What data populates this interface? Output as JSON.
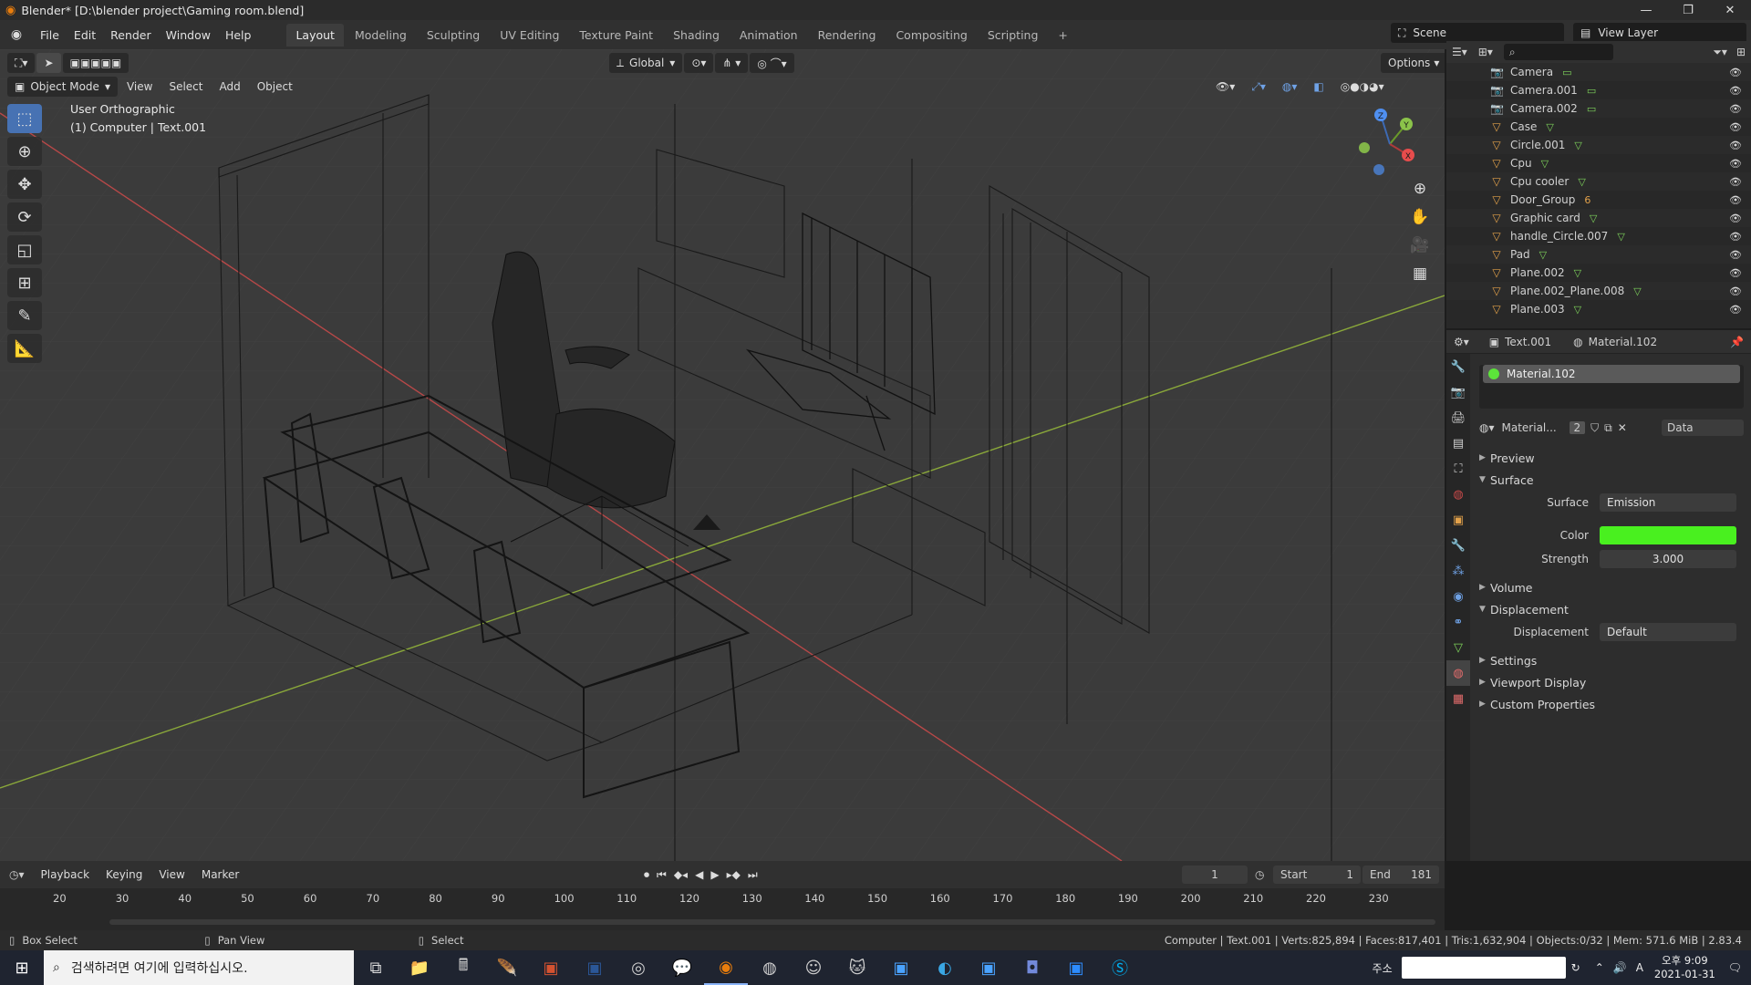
{
  "window": {
    "title": "Blender* [D:\\blender project\\Gaming room.blend]",
    "min": "—",
    "max": "❐",
    "close": "✕"
  },
  "menu": {
    "items": [
      "File",
      "Edit",
      "Render",
      "Window",
      "Help"
    ]
  },
  "workspaces": [
    "Layout",
    "Modeling",
    "Sculpting",
    "UV Editing",
    "Texture Paint",
    "Shading",
    "Animation",
    "Rendering",
    "Compositing",
    "Scripting",
    "+"
  ],
  "active_workspace": "Layout",
  "scene": {
    "label": "Scene",
    "view_layer": "View Layer"
  },
  "viewport": {
    "mode": "Object Mode",
    "menus": [
      "View",
      "Select",
      "Add",
      "Object"
    ],
    "transform": "Global",
    "options": "Options",
    "info_line1": "User Orthographic",
    "info_line2": "(1) Computer | Text.001",
    "gizmo": {
      "x": "X",
      "y": "Y",
      "z": "Z"
    }
  },
  "outliner": {
    "items": [
      {
        "name": "Camera",
        "type": "camera"
      },
      {
        "name": "Camera.001",
        "type": "camera"
      },
      {
        "name": "Camera.002",
        "type": "camera"
      },
      {
        "name": "Case",
        "type": "mesh"
      },
      {
        "name": "Circle.001",
        "type": "mesh"
      },
      {
        "name": "Cpu",
        "type": "mesh"
      },
      {
        "name": "Cpu cooler",
        "type": "mesh"
      },
      {
        "name": "Door_Group",
        "type": "mesh",
        "badge": "6"
      },
      {
        "name": "Graphic card",
        "type": "mesh"
      },
      {
        "name": "handle_Circle.007",
        "type": "mesh"
      },
      {
        "name": "Pad",
        "type": "mesh"
      },
      {
        "name": "Plane.002",
        "type": "mesh"
      },
      {
        "name": "Plane.002_Plane.008",
        "type": "mesh"
      },
      {
        "name": "Plane.003",
        "type": "mesh"
      }
    ]
  },
  "properties": {
    "object": "Text.001",
    "material": "Material.102",
    "slot": "Material.102",
    "mat_name": "Material...",
    "users": "2",
    "link": "Data",
    "panels": {
      "preview": "Preview",
      "surface": "Surface",
      "volume": "Volume",
      "displacement": "Displacement",
      "settings": "Settings",
      "viewport_display": "Viewport Display",
      "custom_props": "Custom Properties"
    },
    "fields": {
      "surface_label": "Surface",
      "surface_value": "Emission",
      "color_label": "Color",
      "color_value": "#49f01f",
      "strength_label": "Strength",
      "strength_value": "3.000",
      "displacement_label": "Displacement",
      "displacement_value": "Default"
    }
  },
  "timeline": {
    "menus": [
      "Playback",
      "Keying",
      "View",
      "Marker"
    ],
    "current_frame": "1",
    "start_label": "Start",
    "start": "1",
    "end_label": "End",
    "end": "181",
    "ruler": [
      "20",
      "30",
      "40",
      "50",
      "60",
      "70",
      "80",
      "90",
      "100",
      "110",
      "120",
      "130",
      "140",
      "150",
      "160",
      "170",
      "180",
      "190",
      "200",
      "210",
      "220",
      "230"
    ]
  },
  "status": {
    "left": "Box Select",
    "mid": "Pan View",
    "right_action": "Select",
    "stats": "Computer | Text.001 | Verts:825,894 | Faces:817,401 | Tris:1,632,904 | Objects:0/32 | Mem: 571.6 MiB | 2.83.4"
  },
  "taskbar": {
    "search_placeholder": "검색하려면 여기에 입력하십시오.",
    "tray_label": "주소",
    "ime": "A",
    "time": "오후 9:09",
    "date": "2021-01-31"
  }
}
